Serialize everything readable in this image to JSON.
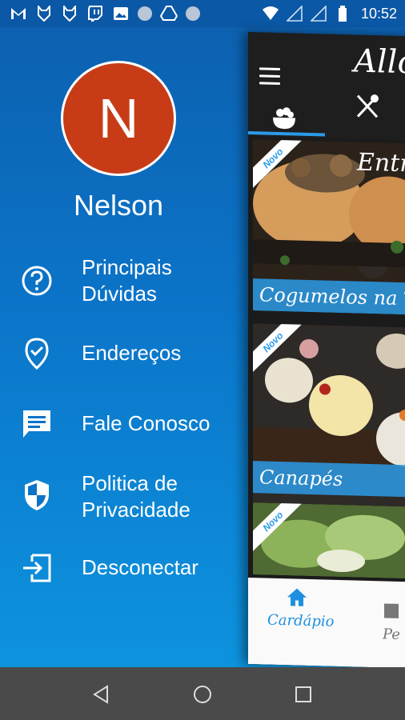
{
  "status_bar": {
    "time": "10:52",
    "left_icons": [
      "gmail-icon",
      "fox-icon",
      "fox-icon",
      "twitch-icon",
      "image-icon",
      "dot-icon",
      "drive-icon",
      "dot-icon"
    ],
    "right_icons": [
      "wifi-icon",
      "signal-icon",
      "signal-icon",
      "battery-icon"
    ]
  },
  "drawer": {
    "avatar_letter": "N",
    "user_name": "Nelson",
    "items": [
      {
        "label": "Principais\nDúvidas",
        "icon": "help-circle-icon"
      },
      {
        "label": "Endereços",
        "icon": "location-check-icon"
      },
      {
        "label": "Fale Conosco",
        "icon": "chat-icon"
      },
      {
        "label": "Politica de\nPrivacidade",
        "icon": "shield-icon"
      },
      {
        "label": "Desconectar",
        "icon": "logout-icon"
      }
    ]
  },
  "app": {
    "brand": "Allo",
    "tabs": [
      "food-bowl-icon",
      "cutlery-icon"
    ],
    "cards": [
      {
        "title": "Cogumelos na To",
        "badge": "Novo",
        "section_title": "Entr"
      },
      {
        "title": "Canapés",
        "badge": "Novo"
      },
      {
        "title": "",
        "badge": "Novo"
      }
    ],
    "bottom_nav": [
      {
        "label": "Cardápio",
        "icon": "home-icon"
      },
      {
        "label": "Pe",
        "icon": "bag-icon"
      }
    ]
  },
  "colors": {
    "accent": "#2a9be8",
    "avatar": "#c73c16",
    "status_bar": "#0b58a6",
    "nav_bar": "#4a4a4a"
  },
  "system_nav": [
    "back-icon",
    "home-circle-icon",
    "recents-icon"
  ]
}
